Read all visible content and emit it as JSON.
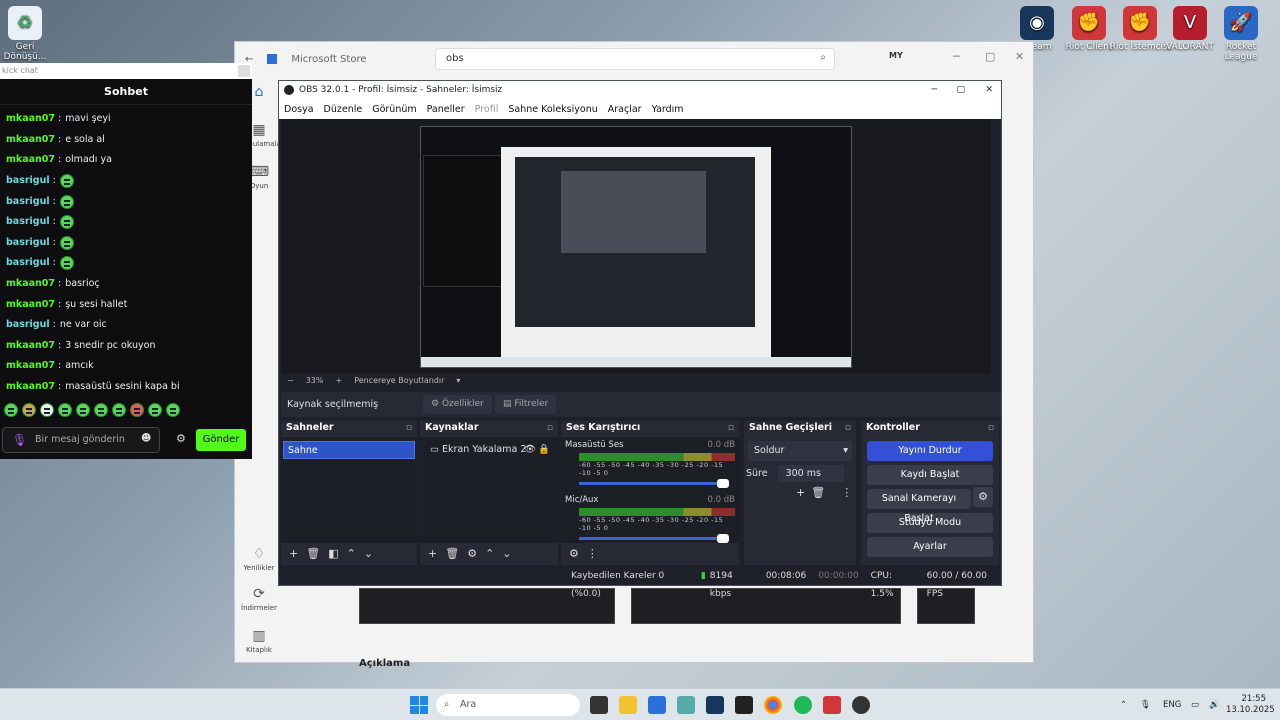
{
  "desktop": {
    "recycle_bin": "Geri Dönüşü...",
    "icons": [
      {
        "label": "Steam"
      },
      {
        "label": "Riot Client"
      },
      {
        "label": "Riot İstemcisi"
      },
      {
        "label": "VALORANT"
      },
      {
        "label": "Rocket League"
      }
    ]
  },
  "store": {
    "app_title": "Microsoft Store",
    "search_value": "obs",
    "avatar": "MY",
    "nav": [
      {
        "label": ""
      },
      {
        "label": "Uygulamalar"
      },
      {
        "label": "Oyun"
      },
      {
        "label": "Yenilikler"
      },
      {
        "label": "İndirmeler"
      },
      {
        "label": "Kitaplık"
      }
    ],
    "description_heading": "Açıklama"
  },
  "chat": {
    "url_text": "kick chat",
    "header": "Sohbet",
    "messages": [
      {
        "user": "mkaan07",
        "text": "mavi şeyi",
        "color": "#53fc18"
      },
      {
        "user": "mkaan07",
        "text": "e sola al",
        "color": "#53fc18"
      },
      {
        "user": "mkaan07",
        "text": "olmadı ya",
        "color": "#53fc18"
      },
      {
        "user": "basrigul",
        "text": "",
        "color": "#6dd9e0",
        "emote": true
      },
      {
        "user": "basrigul",
        "text": "",
        "color": "#6dd9e0",
        "emote": true
      },
      {
        "user": "basrigul",
        "text": "",
        "color": "#6dd9e0",
        "emote": true
      },
      {
        "user": "basrigul",
        "text": "",
        "color": "#6dd9e0",
        "emote": true
      },
      {
        "user": "basrigul",
        "text": "",
        "color": "#6dd9e0",
        "emote": true
      },
      {
        "user": "mkaan07",
        "text": "basrioç",
        "color": "#53fc18"
      },
      {
        "user": "mkaan07",
        "text": "şu sesi hallet",
        "color": "#53fc18"
      },
      {
        "user": "basrigul",
        "text": "ne var oic",
        "color": "#6dd9e0"
      },
      {
        "user": "mkaan07",
        "text": "3 snedir pc okuyon",
        "color": "#53fc18"
      },
      {
        "user": "mkaan07",
        "text": "amcık",
        "color": "#53fc18"
      },
      {
        "user": "mkaan07",
        "text": "masaüstü sesini kapa bi",
        "color": "#53fc18"
      }
    ],
    "input_placeholder": "Bir mesaj gönderin",
    "send_label": "Gönder"
  },
  "obs": {
    "title": "OBS 32.0.1 - Profil: İsimsiz - Sahneler: İsimsiz",
    "menu": [
      "Dosya",
      "Düzenle",
      "Görünüm",
      "Paneller",
      "Profil",
      "Sahne Koleksiyonu",
      "Araçlar",
      "Yardım"
    ],
    "zoom": "33%",
    "zoom_mode": "Pencereye Boyutlandır",
    "no_source": "Kaynak seçilmemiş",
    "properties": "Özellikler",
    "filters": "Filtreler",
    "scenes_title": "Sahneler",
    "scene_selected": "Sahne",
    "sources_title": "Kaynaklar",
    "source_item": "Ekran Yakalama 2",
    "mixer_title": "Ses Karıştırıcı",
    "channels": [
      {
        "name": "Masaüstü Ses",
        "db": "0.0 dB"
      },
      {
        "name": "Mic/Aux",
        "db": "0.0 dB"
      }
    ],
    "meter_ticks": "-60 -55 -50 -45 -40 -35 -30 -25 -20 -15 -10 -5 0",
    "transitions_title": "Sahne Geçişleri",
    "transition": "Soldur",
    "duration_label": "Süre",
    "duration_value": "300 ms",
    "controls_title": "Kontroller",
    "controls": [
      "Yayını Durdur",
      "Kaydı Başlat",
      "Sanal Kamerayı Başlat",
      "Stüdyo Modu",
      "Ayarlar"
    ],
    "status": {
      "dropped": "Kaybedilen Kareler 0 (%0.0)",
      "bitrate": "8194 kbps",
      "live_time": "00:08:06",
      "rec_time": "00:00:00",
      "cpu": "CPU: 1.5%",
      "fps": "60.00 / 60.00 FPS"
    }
  },
  "taskbar": {
    "search": "Ara",
    "lang": "ENG",
    "time": "21:55",
    "date": "13.10.2025"
  }
}
